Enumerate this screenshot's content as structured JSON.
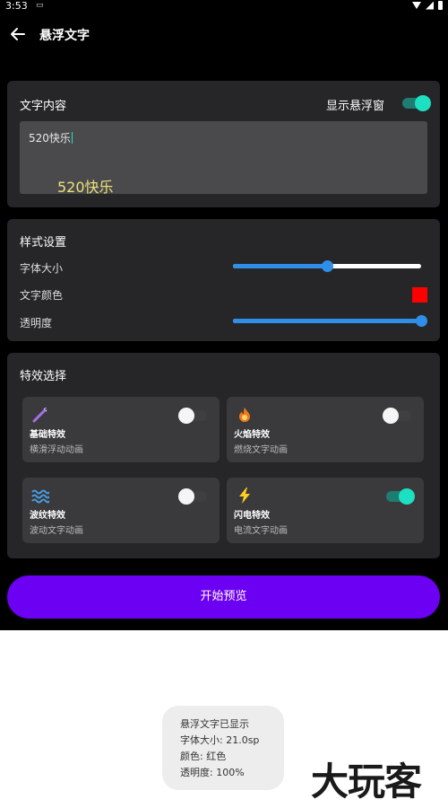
{
  "status_bar": {
    "time": "3:53",
    "notification_icon": "system-notification-icon"
  },
  "header": {
    "title": "悬浮文字",
    "back_icon": "arrow-left-icon"
  },
  "text_card": {
    "title": "文字内容",
    "floating_toggle_label": "显示悬浮窗",
    "floating_toggle_on": true,
    "input_value": "520快乐",
    "preview_text": "520快乐",
    "preview_color": "#ece27a"
  },
  "style_card": {
    "title": "样式设置",
    "font_size_label": "字体大小",
    "font_size_level": 0.5,
    "color_label": "文字颜色",
    "color_value": "#ff0000",
    "opacity_label": "透明度",
    "opacity_level": 1.0
  },
  "effects_card": {
    "title": "特效选择",
    "effects": [
      {
        "name": "基础特效",
        "desc": "横滑浮动动画",
        "icon": "magic-wand-icon",
        "on": false
      },
      {
        "name": "火焰特效",
        "desc": "燃烧文字动画",
        "icon": "fire-icon",
        "on": false
      },
      {
        "name": "波纹特效",
        "desc": "波动文字动画",
        "icon": "wave-icon",
        "on": false
      },
      {
        "name": "闪电特效",
        "desc": "电流文字动画",
        "icon": "lightning-icon",
        "on": true
      }
    ]
  },
  "start_button": {
    "label": "开始预览"
  },
  "toast": {
    "line1": "悬浮文字已显示",
    "line2": "字体大小: 21.0sp",
    "line3": "颜色: 红色",
    "line4": "透明度: 100%"
  },
  "watermark": {
    "text": "大玩客"
  },
  "colors": {
    "accent": "#6c00f2",
    "toggle_on": "#1de0c2",
    "slider": "#2f8fe8",
    "card_bg": "#262628"
  }
}
